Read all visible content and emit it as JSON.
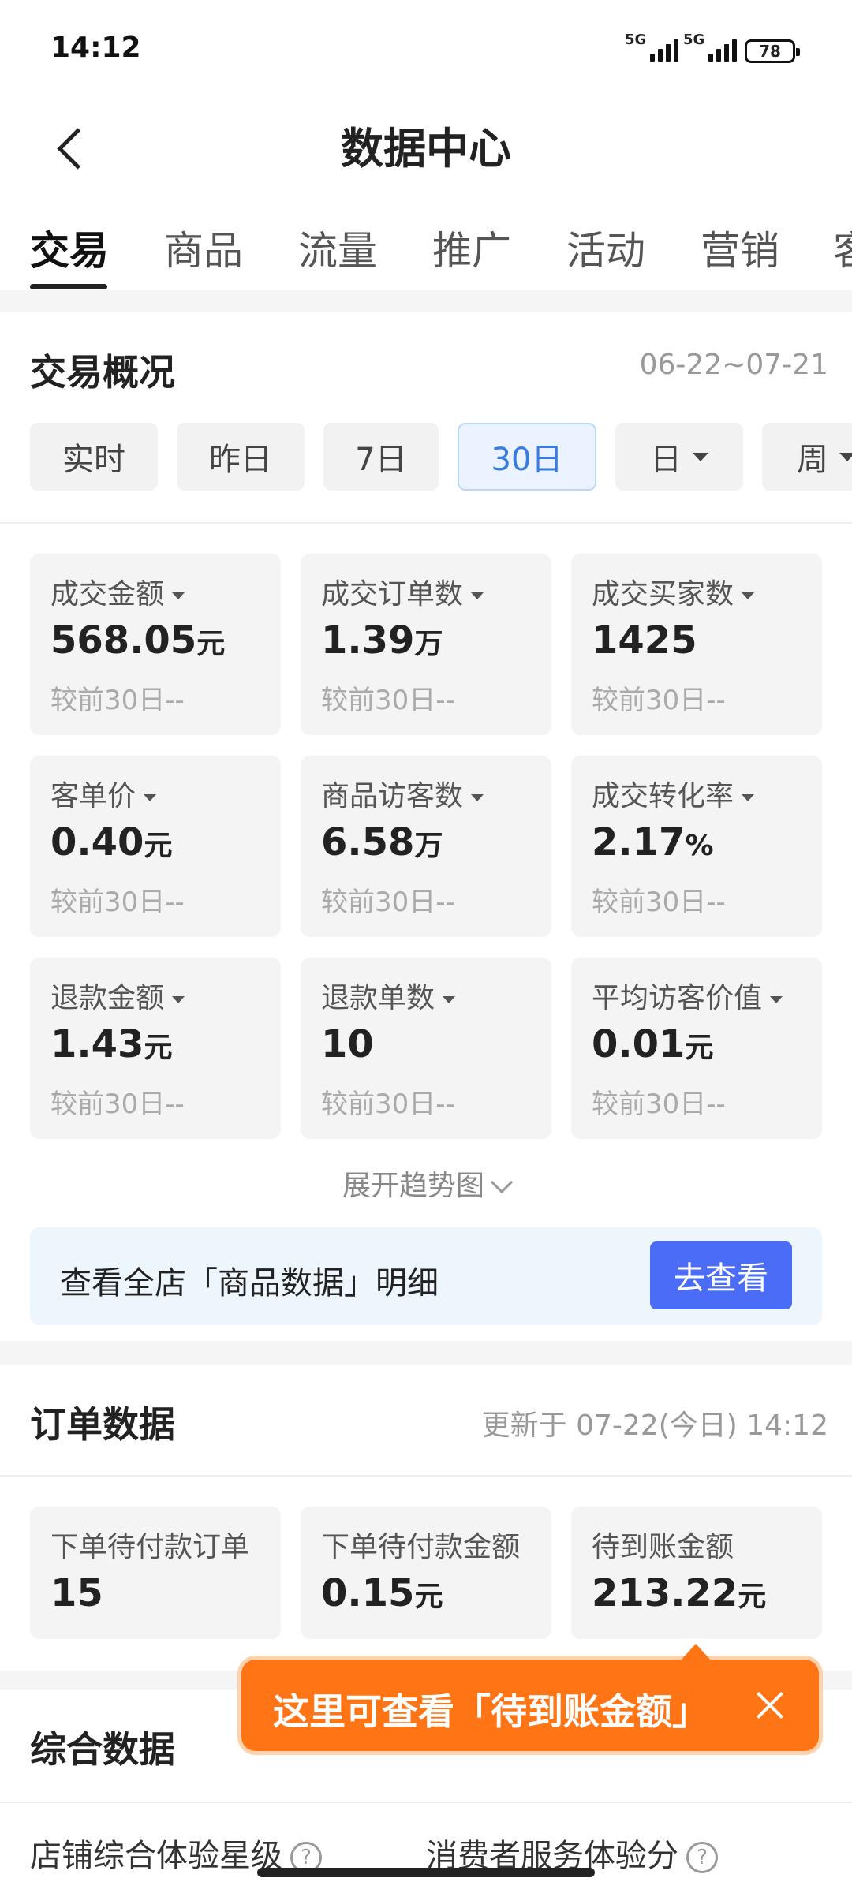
{
  "status": {
    "time": "14:12",
    "net1": "5G",
    "net2": "5G",
    "battery": "78"
  },
  "header": {
    "title": "数据中心"
  },
  "tabs": [
    "交易",
    "商品",
    "流量",
    "推广",
    "活动",
    "营销",
    "客"
  ],
  "overview": {
    "title": "交易概况",
    "date_range": "06-22~07-21",
    "chips": [
      "实时",
      "昨日",
      "7日",
      "30日",
      "日",
      "周"
    ],
    "active_chip": "30日",
    "metrics": [
      {
        "label": "成交金额",
        "value": "568.05",
        "unit": "元",
        "cmp": "较前30日--"
      },
      {
        "label": "成交订单数",
        "value": "1.39",
        "unit": "万",
        "cmp": "较前30日--"
      },
      {
        "label": "成交买家数",
        "value": "1425",
        "unit": "",
        "cmp": "较前30日--"
      },
      {
        "label": "客单价",
        "value": "0.40",
        "unit": "元",
        "cmp": "较前30日--"
      },
      {
        "label": "商品访客数",
        "value": "6.58",
        "unit": "万",
        "cmp": "较前30日--"
      },
      {
        "label": "成交转化率",
        "value": "2.17",
        "unit": "%",
        "cmp": "较前30日--"
      },
      {
        "label": "退款金额",
        "value": "1.43",
        "unit": "元",
        "cmp": "较前30日--"
      },
      {
        "label": "退款单数",
        "value": "10",
        "unit": "",
        "cmp": "较前30日--"
      },
      {
        "label": "平均访客价值",
        "value": "0.01",
        "unit": "元",
        "cmp": "较前30日--"
      }
    ],
    "expand_label": "展开趋势图",
    "banner_text": "查看全店「商品数据」明细",
    "banner_button": "去查看"
  },
  "orders": {
    "title": "订单数据",
    "updated": "更新于 07-22(今日) 14:12",
    "cards": [
      {
        "label": "下单待付款订单",
        "value": "15",
        "unit": ""
      },
      {
        "label": "下单待付款金额",
        "value": "0.15",
        "unit": "元"
      },
      {
        "label": "待到账金额",
        "value": "213.22",
        "unit": "元"
      }
    ]
  },
  "tooltip": {
    "text": "这里可查看「待到账金额」"
  },
  "composite": {
    "title": "综合数据",
    "items": [
      "店铺综合体验星级",
      "消费者服务体验分"
    ]
  }
}
